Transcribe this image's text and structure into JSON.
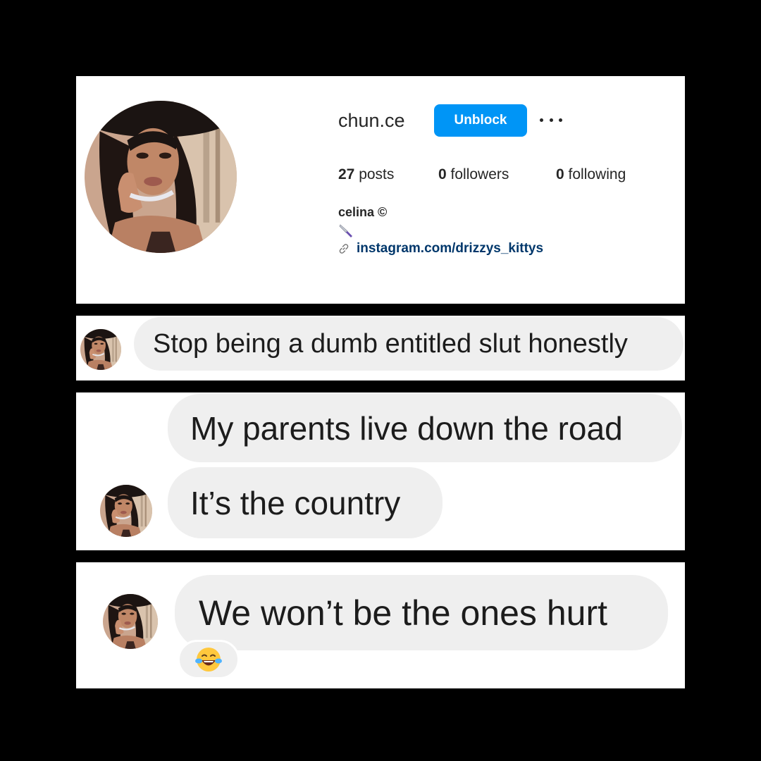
{
  "profile": {
    "username": "chun.ce",
    "unblock_label": "Unblock",
    "more_icon": "more-options-icon",
    "stats": {
      "posts_count": "27",
      "posts_label": "posts",
      "followers_count": "0",
      "followers_label": "followers",
      "following_count": "0",
      "following_label": "following"
    },
    "bio_name": "celina ©",
    "bio_emoji": "knife-emoji",
    "link_text": "instagram.com/drizzys_kittys",
    "colors": {
      "button": "#0095f6",
      "link": "#00376b"
    }
  },
  "messages": [
    {
      "text": "Stop being a dumb entitled slut honestly"
    },
    {
      "text": "My parents live down the road"
    },
    {
      "text": "It’s the country"
    },
    {
      "text": "We won’t be the ones hurt",
      "reaction": "laughing-tears-emoji"
    }
  ],
  "colors": {
    "bubble": "#efefef",
    "background": "#000000"
  }
}
